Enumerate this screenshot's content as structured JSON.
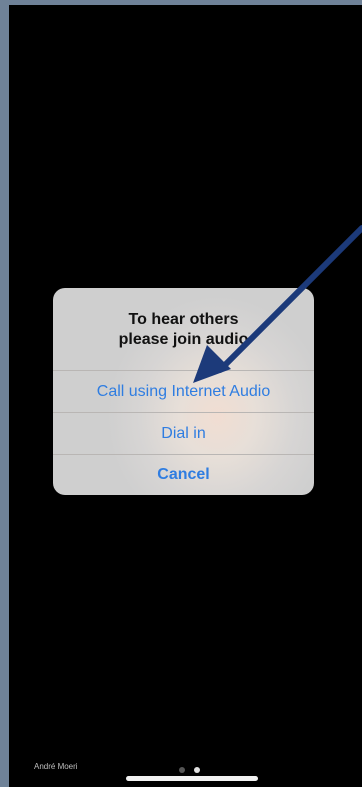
{
  "dialog": {
    "title_line1": "To hear others",
    "title_line2": "please join audio",
    "buttons": {
      "internet_audio": "Call using Internet Audio",
      "dial_in": "Dial in",
      "cancel": "Cancel"
    }
  },
  "footer": {
    "author": "André Moeri",
    "page_dots": {
      "count": 2,
      "active_index": 1
    }
  },
  "colors": {
    "accent_blue": "#2f7de1",
    "annotation_arrow": "#1c3a7a",
    "screen_background": "#000000",
    "frame_background": "#6f8298"
  },
  "icons": [
    "annotation-arrow-icon"
  ]
}
